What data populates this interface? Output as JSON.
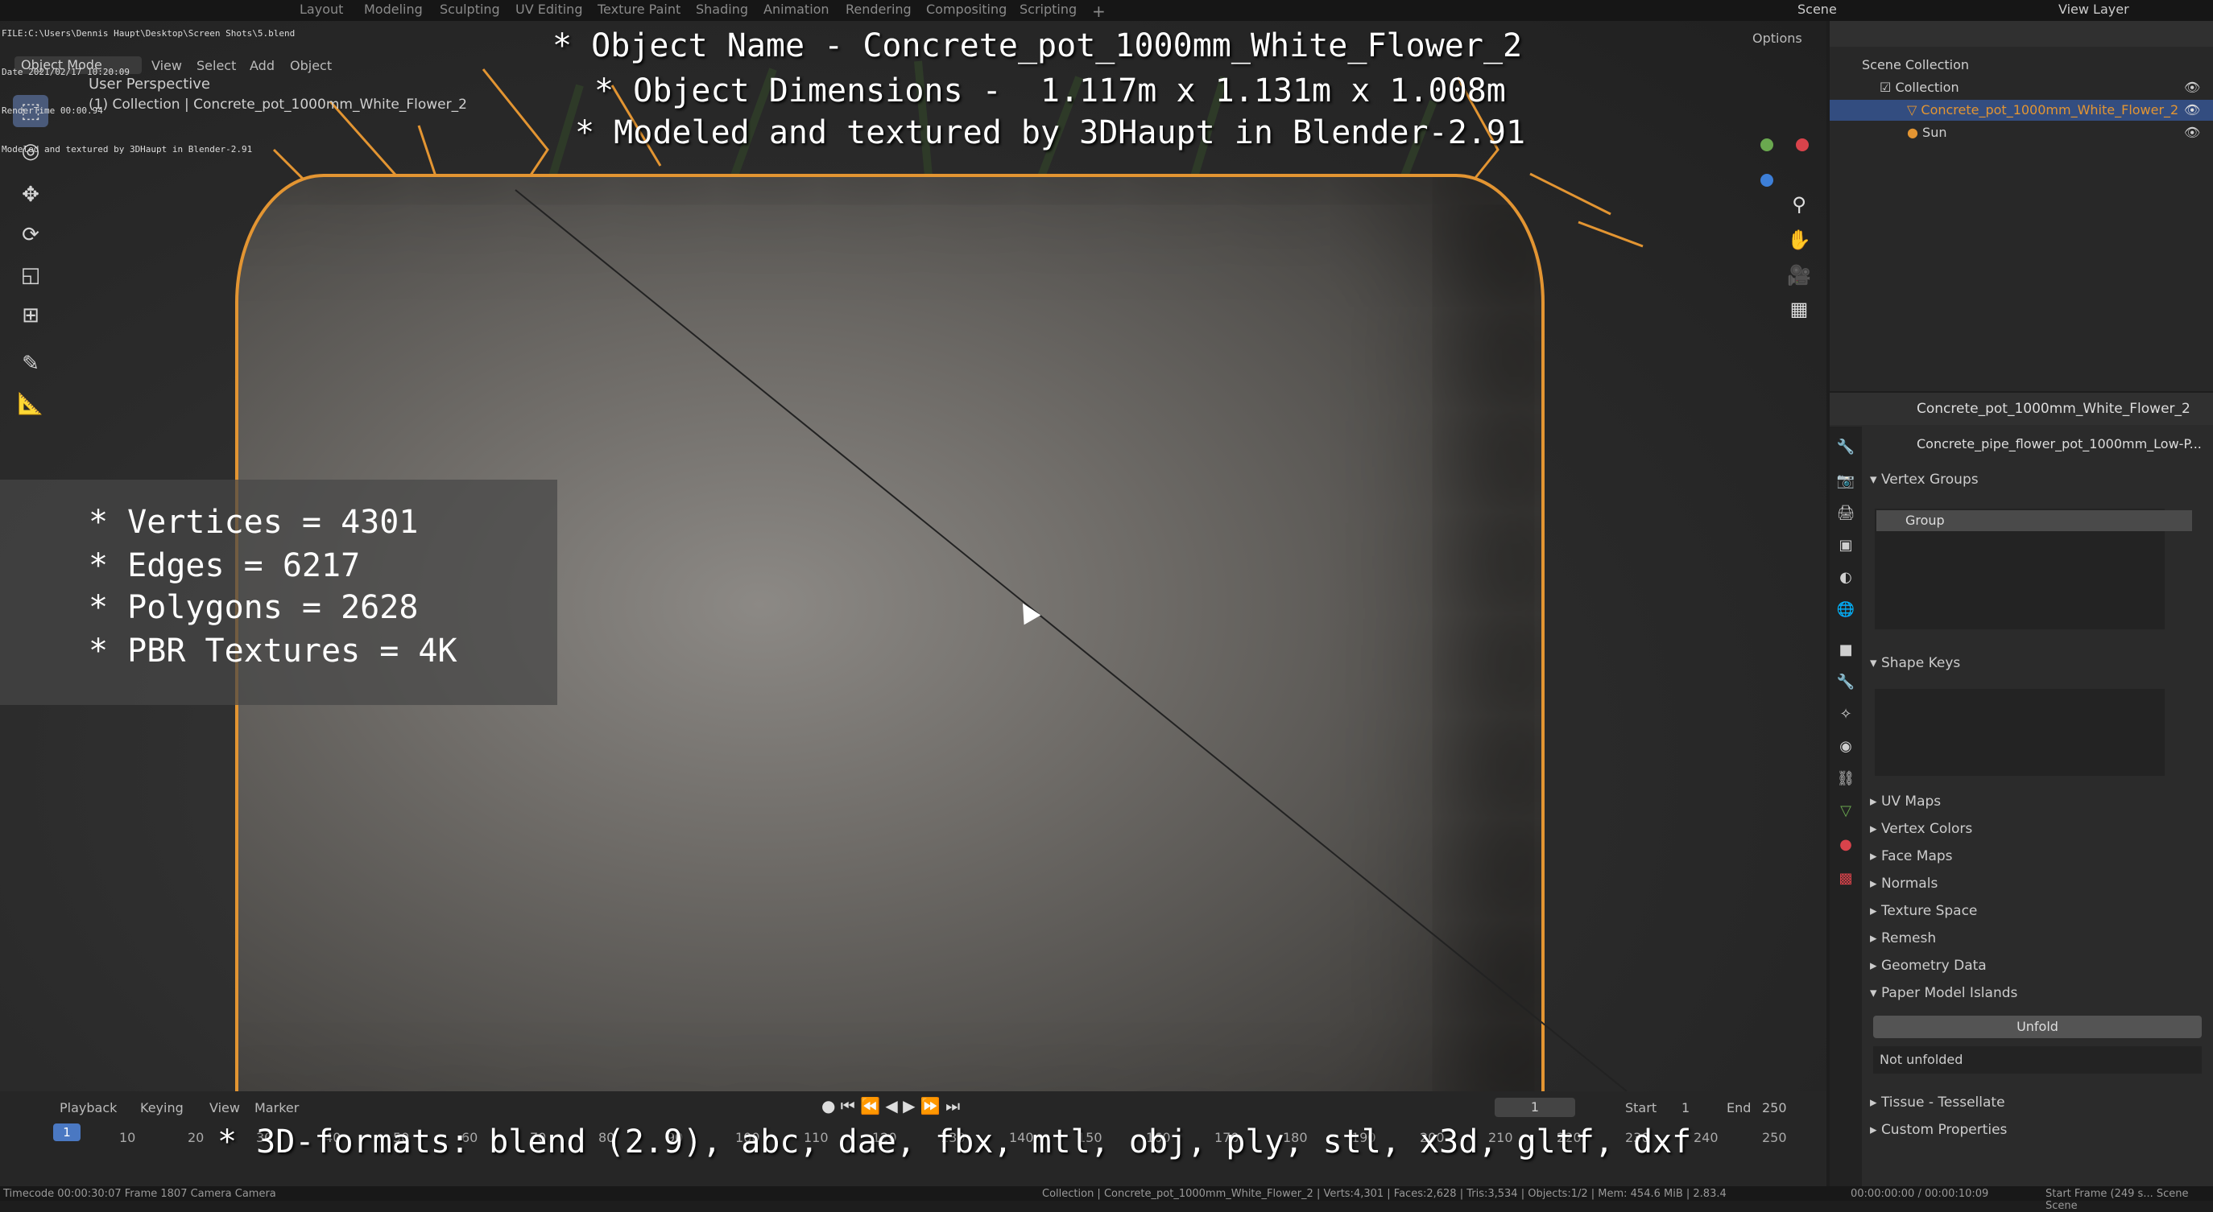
{
  "window": {
    "scene": "Scene",
    "view_layer": "View Layer"
  },
  "topbar": {
    "tabs": [
      "Layout",
      "Modeling",
      "Sculpting",
      "UV Editing",
      "Texture Paint",
      "Shading",
      "Animation",
      "Rendering",
      "Compositing",
      "Scripting"
    ],
    "active_tab": "Layout",
    "add": "+"
  },
  "render_info": {
    "file": "FILE:C:\\Users\\Dennis Haupt\\Desktop\\Screen Shots\\5.blend",
    "date": "Date 2021/02/17 10:20:09",
    "rendertime": "RenderTime 00:00.94",
    "credit": "Modeled and textured by 3DHaupt in Blender-2.91"
  },
  "viewport": {
    "mode": "Object Mode",
    "menus": [
      "View",
      "Select",
      "Add",
      "Object"
    ],
    "options": "Options",
    "perspective": "User Perspective",
    "collection_label": "(1) Collection | Concrete_pot_1000mm_White_Flower_2"
  },
  "overlay_text": {
    "line1": "* Object Name - Concrete_pot_1000mm_White_Flower_2",
    "line2": "* Object Dimensions -  1.117m x 1.131m x 1.008m",
    "line3": "* Modeled and textured by 3DHaupt in Blender-2.91",
    "stats": [
      "* Vertices = 4301",
      "* Edges = 6217",
      "* Polygons = 2628",
      "* PBR Textures = 4K"
    ],
    "formats": "* 3D-formats: blend (2.9), abc, dae, fbx, mtl, obj, ply, stl, x3d, gltf, dxf"
  },
  "outliner": {
    "scene_collection": "Scene Collection",
    "collection": "Collection",
    "object": "Concrete_pot_1000mm_White_Flower_2",
    "sun": "Sun"
  },
  "properties": {
    "object_name": "Concrete_pot_1000mm_White_Flower_2",
    "mesh_name": "Concrete_pipe_flower_pot_1000mm_Low-P...",
    "vertex_groups": "Vertex Groups",
    "group_item": "Group",
    "shape_keys": "Shape Keys",
    "sections": [
      "UV Maps",
      "Vertex Colors",
      "Face Maps",
      "Normals",
      "Texture Space",
      "Remesh",
      "Geometry Data",
      "Paper Model Islands"
    ],
    "unfold": "Unfold",
    "not_unfolded": "Not unfolded",
    "tissue": "Tissue - Tessellate",
    "custom_properties": "Custom Properties"
  },
  "timeline": {
    "menus": [
      "Playback",
      "Keying",
      "View",
      "Marker"
    ],
    "current_frame": "1",
    "start_label": "Start",
    "start": "1",
    "end_label": "End",
    "end": "250",
    "ticks": [
      "10",
      "20",
      "30",
      "40",
      "50",
      "60",
      "70",
      "80",
      "90",
      "100",
      "110",
      "120",
      "130",
      "140",
      "150",
      "160",
      "170",
      "180",
      "190",
      "200",
      "210",
      "220",
      "230",
      "240",
      "250"
    ],
    "playhead": "1"
  },
  "statusbar": {
    "left": "Timecode 00:00:30:07   Frame 1807   Camera Camera",
    "stats": "Collection | Concrete_pot_1000mm_White_Flower_2 | Verts:4,301 | Faces:2,628 | Tris:3,534 | Objects:1/2 | Mem: 454.6 MiB | 2.83.4",
    "time": "00:00:00:00 / 00:00:10:09",
    "right": "Start Frame (249 s...  Scene  Scene"
  },
  "colors": {
    "accent": "#e39532",
    "selected_row": "#334d80",
    "bg": "#1d1d1d"
  }
}
